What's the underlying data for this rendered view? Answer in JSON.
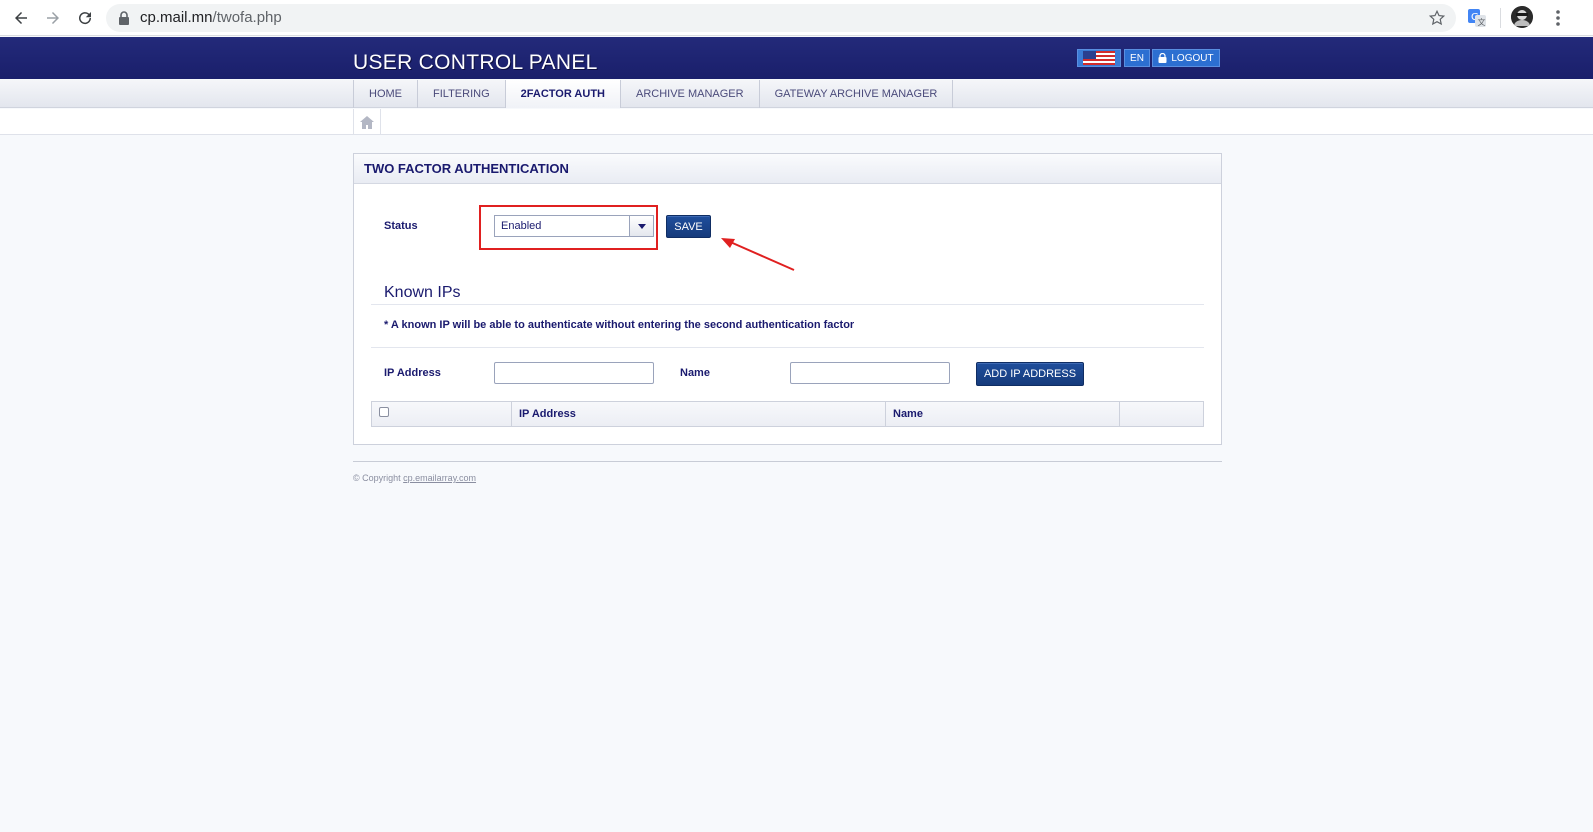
{
  "browser": {
    "url_host": "cp.mail.mn",
    "url_path": "/twofa.php"
  },
  "header": {
    "title": "USER CONTROL PANEL",
    "lang_code": "EN",
    "logout_label": "LOGOUT"
  },
  "nav": {
    "tabs": [
      {
        "label": "HOME"
      },
      {
        "label": "FILTERING"
      },
      {
        "label": "2FACTOR AUTH"
      },
      {
        "label": "ARCHIVE MANAGER"
      },
      {
        "label": "GATEWAY ARCHIVE MANAGER"
      }
    ]
  },
  "panel": {
    "title": "TWO FACTOR AUTHENTICATION",
    "status_label": "Status",
    "status_value": "Enabled",
    "save_label": "SAVE",
    "known_ips_title": "Known IPs",
    "note": "* A known IP will be able to authenticate without entering the second authentication factor",
    "ip_label": "IP Address",
    "name_label": "Name",
    "add_ip_label": "ADD IP ADDRESS",
    "table": {
      "columns": [
        "",
        "IP Address",
        "Name",
        ""
      ]
    }
  },
  "footer": {
    "copyright_prefix": "© Copyright",
    "copyright_link": "cp.emailarray.com"
  },
  "colors": {
    "header_bg": "#1a1f6b",
    "accent_button": "#1f4e9c",
    "highlight": "#e02020",
    "text": "#1a1a6e"
  }
}
